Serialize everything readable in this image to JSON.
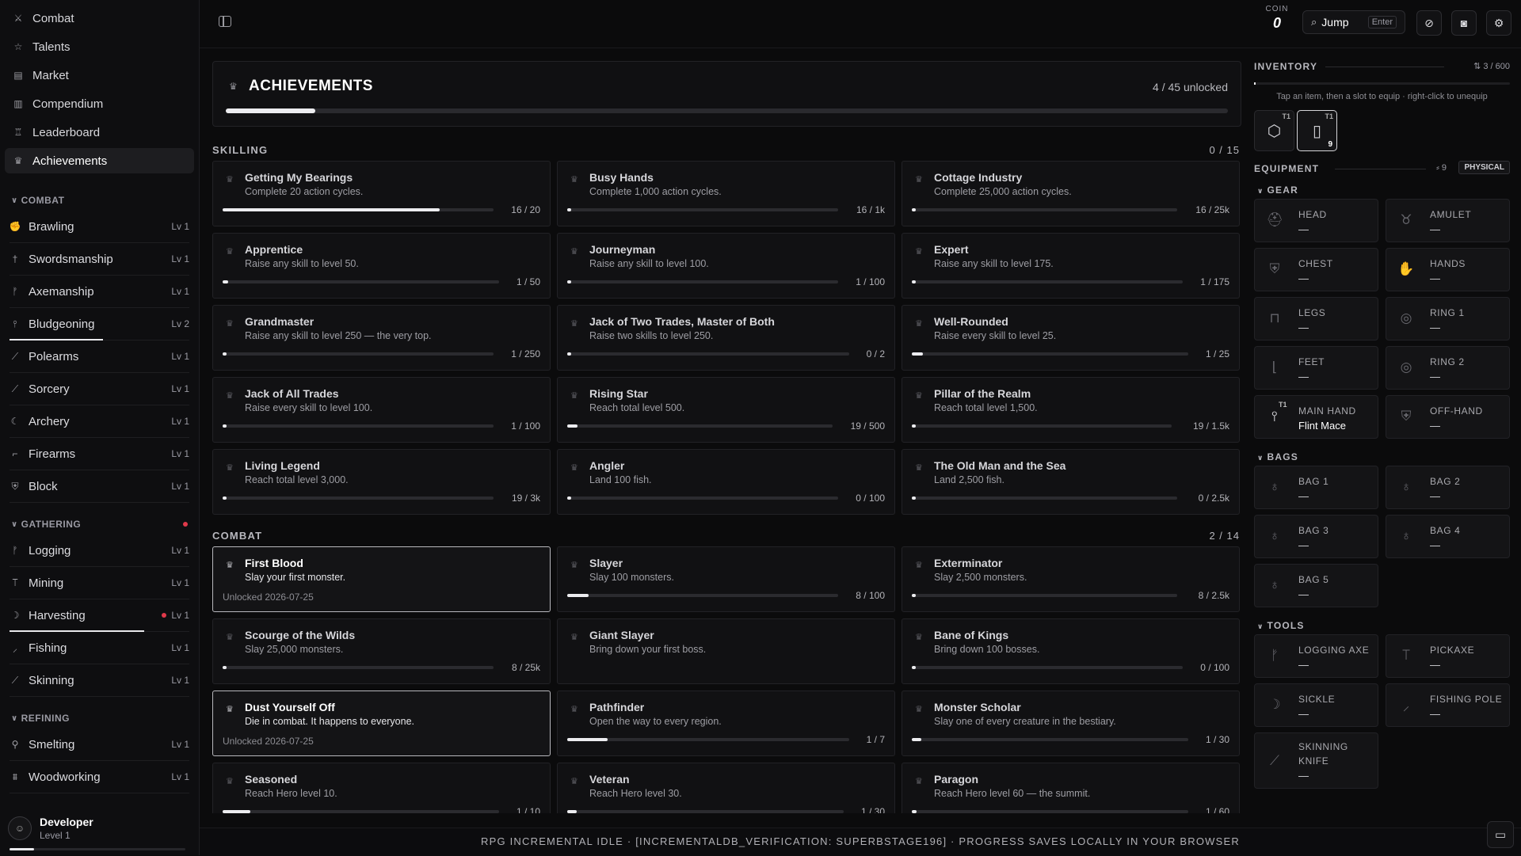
{
  "nav": [
    {
      "label": "Combat",
      "icon": "swords-icon"
    },
    {
      "label": "Talents",
      "icon": "star-icon"
    },
    {
      "label": "Market",
      "icon": "store-icon"
    },
    {
      "label": "Compendium",
      "icon": "book-icon"
    },
    {
      "label": "Leaderboard",
      "icon": "trophy-icon"
    },
    {
      "label": "Achievements",
      "icon": "crown-icon",
      "active": true
    }
  ],
  "skill_groups": [
    {
      "title": "COMBAT",
      "alert": false,
      "skills": [
        {
          "name": "Brawling",
          "level": "Lv 1",
          "xp": 0,
          "icon": "fist-icon"
        },
        {
          "name": "Swordsmanship",
          "level": "Lv 1",
          "xp": 0,
          "icon": "sword-icon"
        },
        {
          "name": "Axemanship",
          "level": "Lv 1",
          "xp": 0,
          "icon": "axe-icon"
        },
        {
          "name": "Bludgeoning",
          "level": "Lv 2",
          "xp": 0.52,
          "icon": "mace-icon"
        },
        {
          "name": "Polearms",
          "level": "Lv 1",
          "xp": 0,
          "icon": "spear-icon"
        },
        {
          "name": "Sorcery",
          "level": "Lv 1",
          "xp": 0,
          "icon": "wand-icon"
        },
        {
          "name": "Archery",
          "level": "Lv 1",
          "xp": 0,
          "icon": "bow-icon"
        },
        {
          "name": "Firearms",
          "level": "Lv 1",
          "xp": 0,
          "icon": "gun-icon"
        },
        {
          "name": "Block",
          "level": "Lv 1",
          "xp": 0,
          "icon": "shield-icon"
        }
      ]
    },
    {
      "title": "GATHERING",
      "alert": true,
      "skills": [
        {
          "name": "Logging",
          "level": "Lv 1",
          "xp": 0,
          "icon": "axe-icon"
        },
        {
          "name": "Mining",
          "level": "Lv 1",
          "xp": 0,
          "icon": "pickaxe-icon"
        },
        {
          "name": "Harvesting",
          "level": "Lv 1",
          "xp": 0.75,
          "icon": "sickle-icon",
          "alert": true
        },
        {
          "name": "Fishing",
          "level": "Lv 1",
          "xp": 0,
          "icon": "fishing-rod-icon"
        },
        {
          "name": "Skinning",
          "level": "Lv 1",
          "xp": 0,
          "icon": "knife-icon"
        }
      ]
    },
    {
      "title": "REFINING",
      "alert": false,
      "skills": [
        {
          "name": "Smelting",
          "level": "Lv 1",
          "xp": 0,
          "icon": "flame-icon"
        },
        {
          "name": "Woodworking",
          "level": "Lv 1",
          "xp": 0,
          "icon": "saw-icon"
        }
      ]
    }
  ],
  "developer": {
    "name": "Developer",
    "level": "Level 1",
    "progress": 0.14
  },
  "topbar": {
    "coin_label": "COIN",
    "coin_value": "0",
    "jump_label": "Jump",
    "jump_key": "Enter"
  },
  "achievements": {
    "title": "ACHIEVEMENTS",
    "unlocked_text": "4 / 45 unlocked",
    "progress": 0.089,
    "categories": [
      {
        "name": "SKILLING",
        "count": "0 / 15",
        "items": [
          {
            "title": "Getting My Bearings",
            "desc": "Complete 20 action cycles.",
            "progress": 0.8,
            "value": "16 / 20"
          },
          {
            "title": "Busy Hands",
            "desc": "Complete 1,000 action cycles.",
            "progress": 0.016,
            "value": "16 / 1k"
          },
          {
            "title": "Cottage Industry",
            "desc": "Complete 25,000 action cycles.",
            "progress": 0.0006,
            "value": "16 / 25k"
          },
          {
            "title": "Apprentice",
            "desc": "Raise any skill to level 50.",
            "progress": 0.02,
            "value": "1 / 50"
          },
          {
            "title": "Journeyman",
            "desc": "Raise any skill to level 100.",
            "progress": 0.01,
            "value": "1 / 100"
          },
          {
            "title": "Expert",
            "desc": "Raise any skill to level 175.",
            "progress": 0.006,
            "value": "1 / 175"
          },
          {
            "title": "Grandmaster",
            "desc": "Raise any skill to level 250 — the very top.",
            "progress": 0.004,
            "value": "1 / 250"
          },
          {
            "title": "Jack of Two Trades, Master of Both",
            "desc": "Raise two skills to level 250.",
            "progress": 0,
            "value": "0 / 2"
          },
          {
            "title": "Well-Rounded",
            "desc": "Raise every skill to level 25.",
            "progress": 0.04,
            "value": "1 / 25"
          },
          {
            "title": "Jack of All Trades",
            "desc": "Raise every skill to level 100.",
            "progress": 0.01,
            "value": "1 / 100"
          },
          {
            "title": "Rising Star",
            "desc": "Reach total level 500.",
            "progress": 0.038,
            "value": "19 / 500"
          },
          {
            "title": "Pillar of the Realm",
            "desc": "Reach total level 1,500.",
            "progress": 0.013,
            "value": "19 / 1.5k"
          },
          {
            "title": "Living Legend",
            "desc": "Reach total level 3,000.",
            "progress": 0.006,
            "value": "19 / 3k"
          },
          {
            "title": "Angler",
            "desc": "Land 100 fish.",
            "progress": 0,
            "value": "0 / 100"
          },
          {
            "title": "The Old Man and the Sea",
            "desc": "Land 2,500 fish.",
            "progress": 0,
            "value": "0 / 2.5k"
          }
        ]
      },
      {
        "name": "COMBAT",
        "count": "2 / 14",
        "items": [
          {
            "title": "First Blood",
            "desc": "Slay your first monster.",
            "unlocked": "Unlocked 2026-07-25"
          },
          {
            "title": "Slayer",
            "desc": "Slay 100 monsters.",
            "progress": 0.08,
            "value": "8 / 100"
          },
          {
            "title": "Exterminator",
            "desc": "Slay 2,500 monsters.",
            "progress": 0.003,
            "value": "8 / 2.5k"
          },
          {
            "title": "Scourge of the Wilds",
            "desc": "Slay 25,000 monsters.",
            "progress": 0.0003,
            "value": "8 / 25k"
          },
          {
            "title": "Giant Slayer",
            "desc": "Bring down your first boss."
          },
          {
            "title": "Bane of Kings",
            "desc": "Bring down 100 bosses.",
            "progress": 0,
            "value": "0 / 100"
          },
          {
            "title": "Dust Yourself Off",
            "desc": "Die in combat. It happens to everyone.",
            "unlocked": "Unlocked 2026-07-25"
          },
          {
            "title": "Pathfinder",
            "desc": "Open the way to every region.",
            "progress": 0.143,
            "value": "1 / 7"
          },
          {
            "title": "Monster Scholar",
            "desc": "Slay one of every creature in the bestiary.",
            "progress": 0.033,
            "value": "1 / 30"
          },
          {
            "title": "Seasoned",
            "desc": "Reach Hero level 10.",
            "progress": 0.1,
            "value": "1 / 10"
          },
          {
            "title": "Veteran",
            "desc": "Reach Hero level 30.",
            "progress": 0.033,
            "value": "1 / 30"
          },
          {
            "title": "Paragon",
            "desc": "Reach Hero level 60 — the summit.",
            "progress": 0.017,
            "value": "1 / 60"
          }
        ]
      }
    ]
  },
  "inventory": {
    "title": "INVENTORY",
    "capacity": "3 / 600",
    "fill": 0.005,
    "hint": "Tap an item, then a slot to equip · right-click to unequip",
    "items": [
      {
        "icon": "cube-icon",
        "tier": "T1",
        "qty": "",
        "selected": false
      },
      {
        "icon": "jar-icon",
        "tier": "T1",
        "qty": "9",
        "selected": true
      }
    ]
  },
  "equipment": {
    "title": "EQUIPMENT",
    "stat": "9",
    "damage_type": "PHYSICAL",
    "sections": [
      {
        "title": "GEAR",
        "slots": [
          {
            "name": "HEAD",
            "value": "—",
            "icon": "helmet-icon"
          },
          {
            "name": "AMULET",
            "value": "—",
            "icon": "amulet-icon"
          },
          {
            "name": "CHEST",
            "value": "—",
            "icon": "chestplate-icon"
          },
          {
            "name": "HANDS",
            "value": "—",
            "icon": "gloves-icon"
          },
          {
            "name": "LEGS",
            "value": "—",
            "icon": "legs-icon"
          },
          {
            "name": "RING 1",
            "value": "—",
            "icon": "ring-icon"
          },
          {
            "name": "FEET",
            "value": "—",
            "icon": "boot-icon"
          },
          {
            "name": "RING 2",
            "value": "—",
            "icon": "ring-icon"
          },
          {
            "name": "MAIN HAND",
            "value": "Flint Mace",
            "icon": "mace-icon",
            "tier": "T1",
            "filled": true
          },
          {
            "name": "OFF-HAND",
            "value": "—",
            "icon": "shield-icon"
          }
        ]
      },
      {
        "title": "BAGS",
        "slots": [
          {
            "name": "BAG 1",
            "value": "—",
            "icon": "bag-icon"
          },
          {
            "name": "BAG 2",
            "value": "—",
            "icon": "bag-icon"
          },
          {
            "name": "BAG 3",
            "value": "—",
            "icon": "bag-icon"
          },
          {
            "name": "BAG 4",
            "value": "—",
            "icon": "bag-icon"
          },
          {
            "name": "BAG 5",
            "value": "—",
            "icon": "bag-icon"
          }
        ]
      },
      {
        "title": "TOOLS",
        "slots": [
          {
            "name": "LOGGING AXE",
            "value": "—",
            "icon": "axe-icon"
          },
          {
            "name": "PICKAXE",
            "value": "—",
            "icon": "pickaxe-icon"
          },
          {
            "name": "SICKLE",
            "value": "—",
            "icon": "sickle-icon"
          },
          {
            "name": "FISHING POLE",
            "value": "—",
            "icon": "fishing-rod-icon"
          },
          {
            "name": "SKINNING KNIFE",
            "value": "—",
            "icon": "knife-icon"
          }
        ]
      }
    ]
  },
  "footer": "RPG INCREMENTAL IDLE · [INCREMENTALDB_VERIFICATION: SUPERBSTAGE196] · PROGRESS SAVES LOCALLY IN YOUR BROWSER"
}
